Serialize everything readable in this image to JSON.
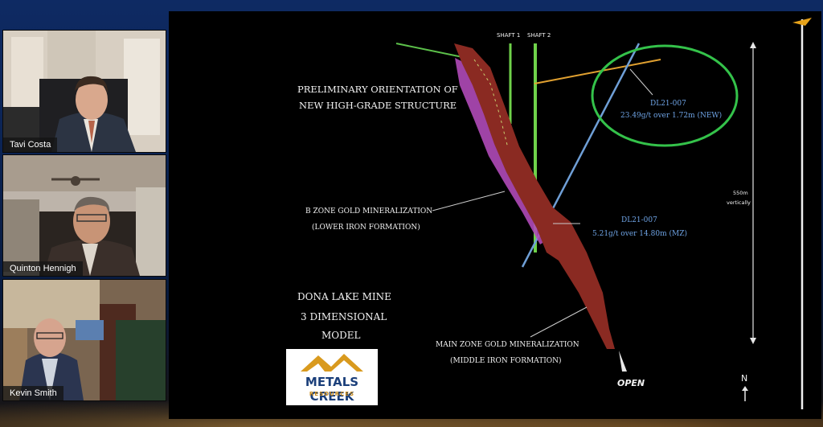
{
  "participants": [
    {
      "name": "Tavi Costa"
    },
    {
      "name": "Quinton Hennigh"
    },
    {
      "name": "Kevin Smith"
    }
  ],
  "slide": {
    "shaft1": "SHAFT 1",
    "shaft2": "SHAFT 2",
    "orientation_line1": "PRELIMINARY ORIENTATION OF",
    "orientation_line2": "NEW HIGH-GRADE STRUCTURE",
    "dl_top_id": "DL21-007",
    "dl_top_value": "23.49g/t over 1.72m (NEW)",
    "bzone_line1": "B ZONE GOLD MINERALIZATION",
    "bzone_line2": "(LOWER IRON FORMATION)",
    "dl_mid_id": "DL21-007",
    "dl_mid_value": "5.21g/t over 14.80m (MZ)",
    "scale_line1": "550m",
    "scale_line2": "vertically",
    "title_line1": "DONA LAKE MINE",
    "title_line2": "3 DIMENSIONAL",
    "title_line3": "MODEL",
    "mainzone_line1": "MAIN ZONE GOLD MINERALIZATION",
    "mainzone_line2": "(MIDDLE IRON FORMATION)",
    "open_label": "OPEN",
    "north_label": "N",
    "logo_line1": "METALS CREEK",
    "logo_line2": "RESOURCES"
  },
  "colors": {
    "highlight_ellipse": "#34c24a",
    "shaft": "#6fd24a",
    "drillhole_blue": "#6f9fd6",
    "orange_hole": "#e0a030",
    "main_zone": "#8a2a22",
    "b_zone": "#b04ab8"
  }
}
